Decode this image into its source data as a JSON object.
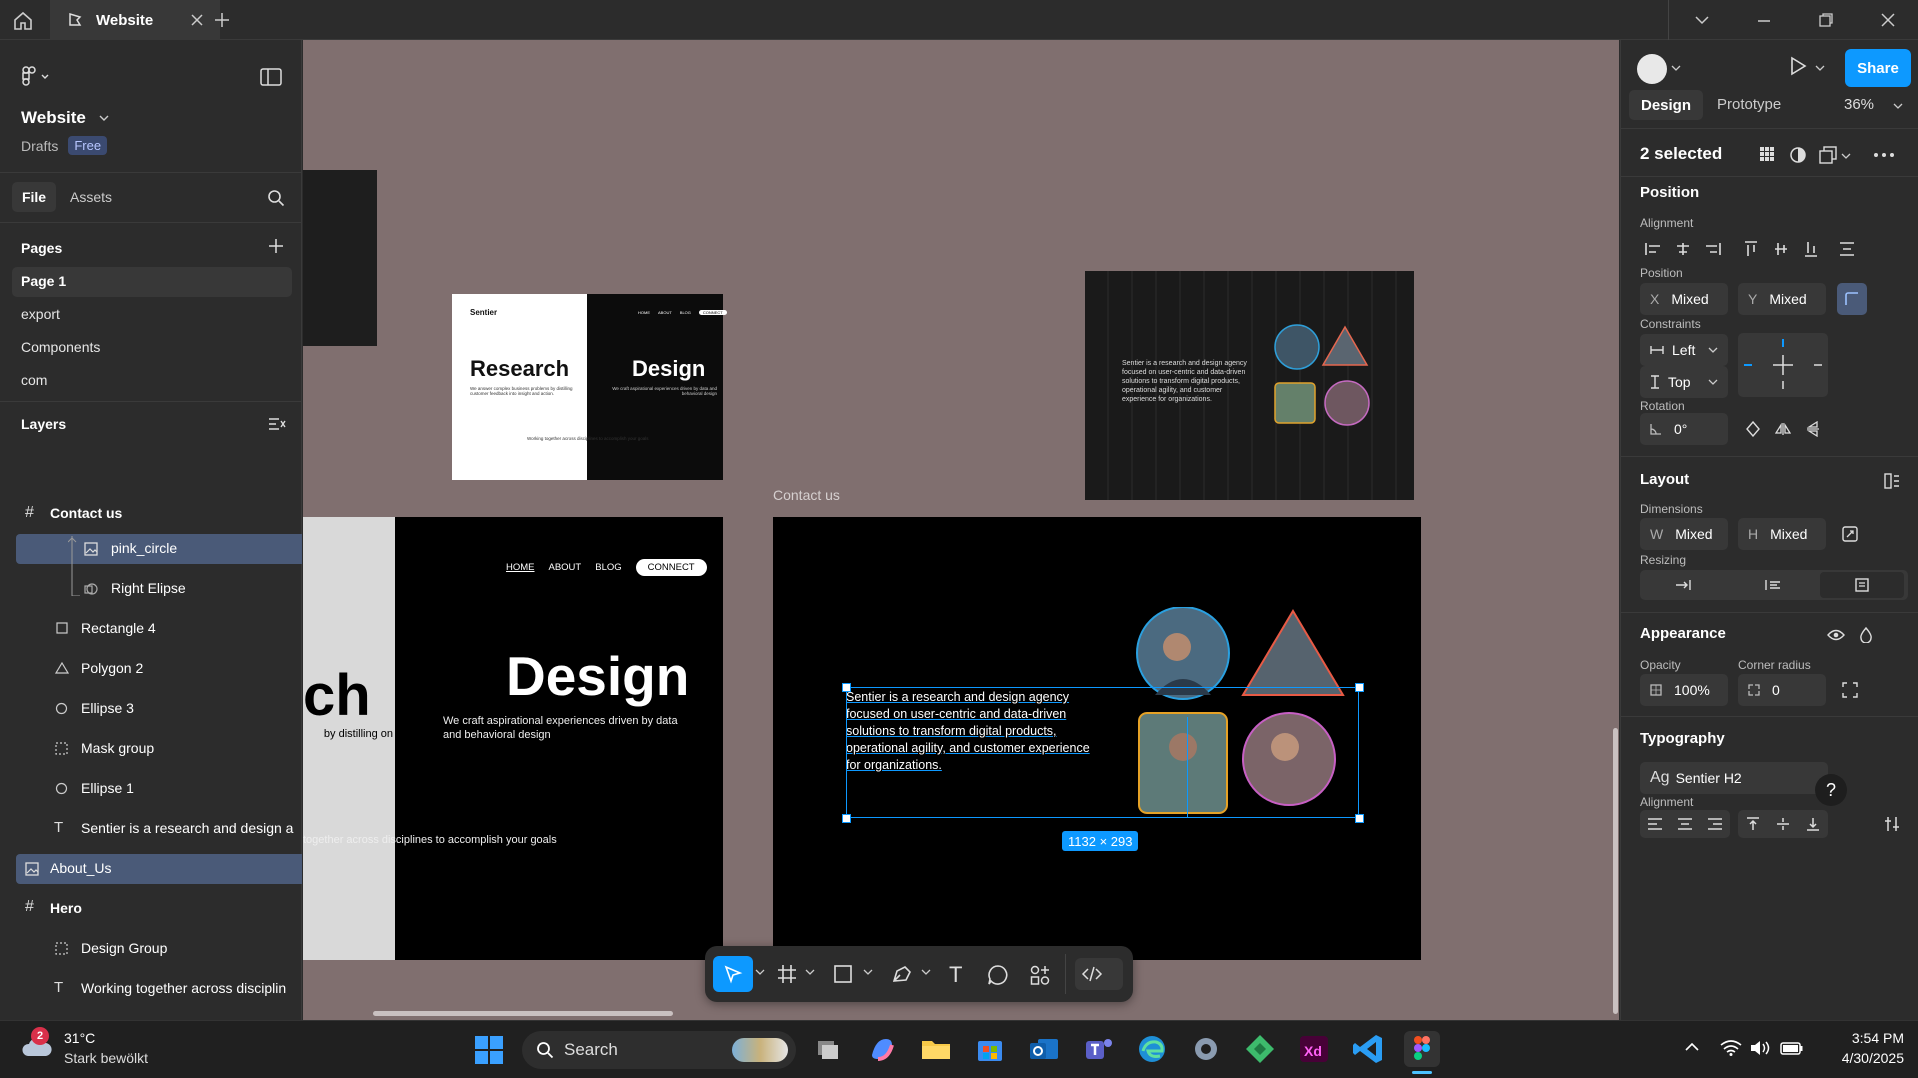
{
  "titlebar": {
    "tab_title": "Website",
    "home_icon": "home-icon",
    "figma_icon": "figma-file-icon",
    "close_tab": "close-icon",
    "new_tab": "plus-icon"
  },
  "left_panel": {
    "file_name": "Website",
    "drafts": "Drafts",
    "plan_badge": "Free",
    "tabs": [
      "File",
      "Assets"
    ],
    "pages_header": "Pages",
    "pages": [
      "Page 1",
      "export",
      "Components",
      "com"
    ],
    "layers_header": "Layers",
    "layers": [
      {
        "name": "Contact us",
        "icon": "frame-icon"
      },
      {
        "name": "pink_circle",
        "icon": "image-icon"
      },
      {
        "name": "Right Elipse",
        "icon": "mask-image-icon"
      },
      {
        "name": "Rectangle 4",
        "icon": "rectangle-icon"
      },
      {
        "name": "Polygon 2",
        "icon": "polygon-icon"
      },
      {
        "name": "Ellipse 3",
        "icon": "ellipse-icon"
      },
      {
        "name": "Mask group",
        "icon": "mask-group-icon"
      },
      {
        "name": "Ellipse 1",
        "icon": "ellipse-icon"
      },
      {
        "name": "Sentier is a research and design a",
        "icon": "text-icon"
      },
      {
        "name": "About_Us",
        "icon": "image-icon"
      },
      {
        "name": "Hero",
        "icon": "frame-icon"
      },
      {
        "name": "Design Group",
        "icon": "group-icon"
      },
      {
        "name": "Working together across disciplin",
        "icon": "text-icon"
      }
    ]
  },
  "canvas": {
    "frame_label": "Contact us",
    "dimension_badge": "1132 × 293",
    "selected_text": "Sentier is a  research and design agency focused on user-centric and data-driven solutions to transform digital products, operational agility, and customer experience for organizations.",
    "thumb_small": {
      "logo": "Sentier",
      "research": "Research",
      "design": "Design",
      "nav": [
        "HOME",
        "ABOUT",
        "BLOG",
        "CONNECT"
      ],
      "left_desc": "We answer complex business problems by distilling customer feedback into insight and action.",
      "right_desc": "We craft aspirational experiences driven by data and behavioral design",
      "footer": "Working together across disciplines to accomplish your goals"
    },
    "hero": {
      "nav": [
        "HOME",
        "ABOUT",
        "BLOG",
        "CONNECT"
      ],
      "left_word": "ch",
      "left_desc": "by distilling on",
      "design_word": "Design",
      "design_desc": "We craft aspirational experiences driven by data and behavioral design",
      "footer": "together across disciplines to accomplish your goals"
    },
    "about_text": "Sentier is a research and design agency focused on user-centric and data-driven solutions to transform digital products, operational agility, and customer experience for organizations."
  },
  "toolbar": {
    "tools": [
      "move-tool-icon",
      "frame-tool-icon",
      "rectangle-tool-icon",
      "pen-tool-icon",
      "text-tool-icon",
      "comment-tool-icon",
      "actions-icon",
      "dev-mode-icon"
    ]
  },
  "right_panel": {
    "tabs": [
      "Design",
      "Prototype"
    ],
    "zoom": "36%",
    "share": "Share",
    "selection": "2 selected",
    "position_title": "Position",
    "alignment_label": "Alignment",
    "position_label": "Position",
    "x_key": "X",
    "x_value": "Mixed",
    "y_key": "Y",
    "y_value": "Mixed",
    "constraints_label": "Constraints",
    "constraint_h": "Left",
    "constraint_v": "Top",
    "rotation_label": "Rotation",
    "rotation_value": "0°",
    "layout_title": "Layout",
    "dimensions_label": "Dimensions",
    "w_key": "W",
    "w_value": "Mixed",
    "h_key": "H",
    "h_value": "Mixed",
    "resizing_label": "Resizing",
    "appearance_title": "Appearance",
    "opacity_label": "Opacity",
    "opacity_value": "100%",
    "corner_label": "Corner radius",
    "corner_value": "0",
    "typography_title": "Typography",
    "font_prefix": "Ag",
    "font_style": "Sentier H2",
    "typo_alignment_label": "Alignment"
  },
  "taskbar": {
    "weather_temp": "31°C",
    "weather_desc": "Stark bewölkt",
    "weather_badge": "2",
    "search": "Search",
    "time": "3:54 PM",
    "date": "4/30/2025"
  },
  "colors": {
    "accent": "#0d99ff",
    "canvas": "#806f6f",
    "panel": "#2c2c2c",
    "selected_layer": "#4a5a78"
  }
}
